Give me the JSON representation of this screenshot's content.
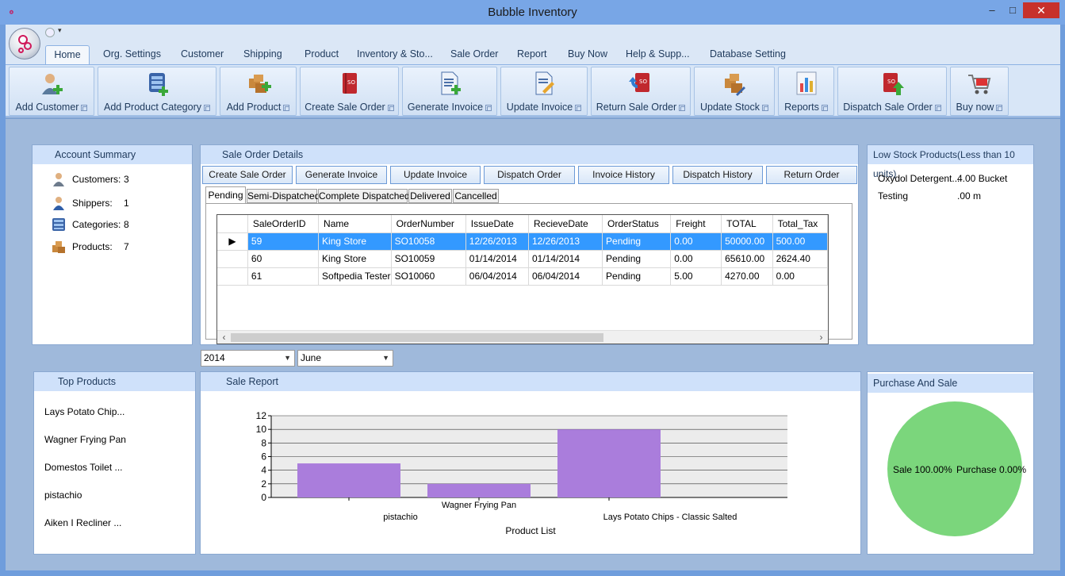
{
  "window": {
    "title": "Bubble Inventory",
    "minimize": "–",
    "maximize": "□",
    "close": "✕"
  },
  "ribbon": {
    "tabs": [
      "Home",
      "Org. Settings",
      "Customer",
      "Shipping",
      "Product",
      "Inventory & Sto...",
      "Sale Order",
      "Report",
      "Buy Now",
      "Help & Supp...",
      "Database Setting"
    ],
    "buttons": [
      {
        "label": "Add Customer",
        "icon": "add-customer-icon"
      },
      {
        "label": "Add Product Category",
        "icon": "add-category-icon"
      },
      {
        "label": "Add Product",
        "icon": "add-product-icon"
      },
      {
        "label": "Create Sale Order",
        "icon": "sale-order-icon"
      },
      {
        "label": "Generate Invoice",
        "icon": "generate-invoice-icon"
      },
      {
        "label": "Update Invoice",
        "icon": "update-invoice-icon"
      },
      {
        "label": "Return Sale Order",
        "icon": "return-order-icon"
      },
      {
        "label": "Update Stock",
        "icon": "update-stock-icon"
      },
      {
        "label": "Reports",
        "icon": "reports-icon"
      },
      {
        "label": "Dispatch Sale Order",
        "icon": "dispatch-order-icon"
      },
      {
        "label": "Buy now",
        "icon": "cart-icon"
      }
    ]
  },
  "account_summary": {
    "title": "Account Summary",
    "rows": [
      {
        "label": "Customers:",
        "value": "3"
      },
      {
        "label": "Shippers:",
        "value": "1"
      },
      {
        "label": "Categories:",
        "value": "8"
      },
      {
        "label": "Products:",
        "value": "7"
      }
    ]
  },
  "sale_order_details": {
    "title": "Sale Order Details",
    "buttons": [
      "Create Sale Order",
      "Generate Invoice",
      "Update Invoice",
      "Dispatch Order",
      "Invoice History",
      "Dispatch History",
      "Return Order"
    ],
    "tabs": [
      "Pending",
      "Semi-Dispatched",
      "Complete Dispatched",
      "Delivered",
      "Cancelled"
    ],
    "columns": [
      "SaleOrderID",
      "Name",
      "OrderNumber",
      "IssueDate",
      "RecieveDate",
      "OrderStatus",
      "Freight",
      "TOTAL",
      "Total_Tax"
    ],
    "rows": [
      [
        "59",
        "King Store",
        "SO10058",
        "12/26/2013",
        "12/26/2013",
        "Pending",
        "0.00",
        "50000.00",
        "500.00"
      ],
      [
        "60",
        "King Store",
        "SO10059",
        "01/14/2014",
        "01/14/2014",
        "Pending",
        "0.00",
        "65610.00",
        "2624.40"
      ],
      [
        "61",
        "Softpedia Tester",
        "SO10060",
        "06/04/2014",
        "06/04/2014",
        "Pending",
        "5.00",
        "4270.00",
        "0.00"
      ]
    ],
    "row_indicator": "▶",
    "scroll_left": "‹",
    "scroll_right": "›"
  },
  "filters": {
    "year": "2014",
    "month": "June",
    "dropdown_glyph": "▼"
  },
  "low_stock": {
    "title": "Low Stock Products(Less than 10 units)",
    "rows": [
      {
        "name": "Oxydol Detergent...",
        "qty": "4.00 Bucket"
      },
      {
        "name": "Testing",
        "qty": ".00 m"
      }
    ]
  },
  "top_products": {
    "title": "Top Products",
    "items": [
      "Lays Potato Chip...",
      "Wagner Frying Pan",
      "Domestos Toilet ...",
      "pistachio",
      "Aiken I Recliner ..."
    ]
  },
  "sale_report": {
    "title": "Sale Report"
  },
  "purchase_sale": {
    "title": "Purchase And Sale",
    "sale_label": "Sale 100.00%",
    "purchase_label": "Purchase 0.00%"
  },
  "chart_data": [
    {
      "type": "bar",
      "categories": [
        "pistachio",
        "Wagner Frying Pan",
        "Lays Potato Chips - Classic Salted"
      ],
      "values": [
        5,
        2,
        10
      ],
      "xlabel": "Product List",
      "ylabel": "",
      "ylim": [
        0,
        12
      ],
      "yticks": [
        0,
        2,
        4,
        6,
        8,
        10,
        12
      ],
      "grid": true,
      "color": "#aa7ddc"
    },
    {
      "type": "pie",
      "labels": [
        "Sale",
        "Purchase"
      ],
      "values": [
        100,
        0
      ],
      "colors": [
        "#7bd67c",
        "#4a90d9"
      ]
    }
  ]
}
